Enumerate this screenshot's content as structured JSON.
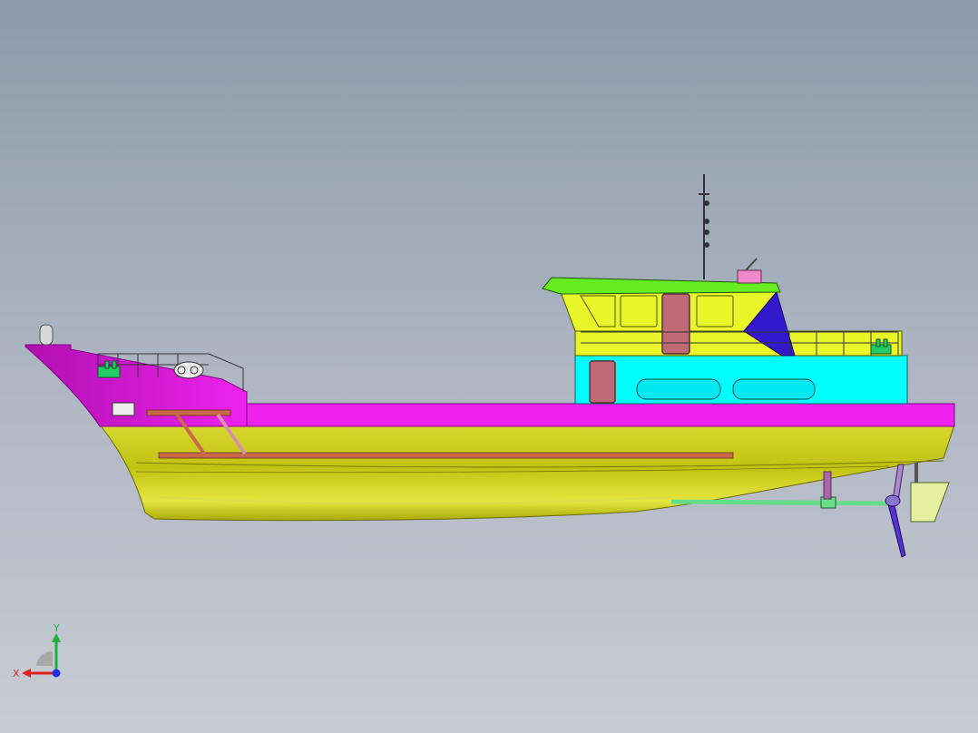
{
  "viewport": {
    "background_top": "#8e9aaa",
    "background_bottom": "#c8ccd4"
  },
  "model": {
    "colors": {
      "hull": "#c8c818",
      "deck_band": "#ee22ee",
      "cabin_lower": "#00ffff",
      "cabin_upper": "#e8f528",
      "roof": "#66ee22",
      "door": "#c06a78",
      "blue_panel": "#3318cc",
      "fittings": "#22cc66"
    }
  },
  "triad": {
    "x_label": "X",
    "y_label": "Y",
    "x_color": "#e52020",
    "y_color": "#20b040",
    "z_color": "#2030e0"
  }
}
